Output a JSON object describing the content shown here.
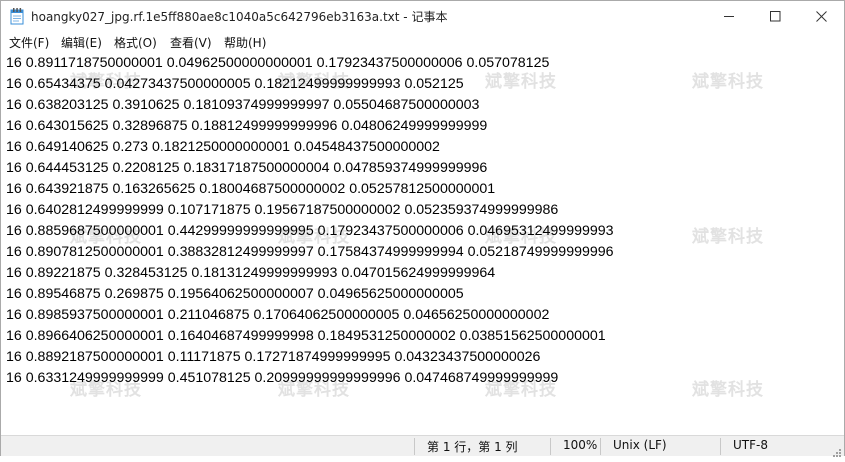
{
  "window": {
    "title": "hoangky027_jpg.rf.1e5ff880ae8c1040a5c642796eb3163a.txt - 记事本"
  },
  "menu": [
    {
      "label": "文件(F)"
    },
    {
      "label": "编辑(E)"
    },
    {
      "label": "格式(O)"
    },
    {
      "label": "查看(V)"
    },
    {
      "label": "帮助(H)"
    }
  ],
  "lines": [
    "16 0.8911718750000001 0.04962500000000001 0.17923437500000006 0.057078125",
    "16 0.65434375 0.04273437500000005 0.18212499999999993 0.052125",
    "16 0.638203125 0.3910625 0.18109374999999997 0.05504687500000003",
    "16 0.643015625 0.32896875 0.18812499999999996 0.04806249999999999",
    "16 0.649140625 0.273 0.1821250000000001 0.04548437500000002",
    "16 0.644453125 0.2208125 0.18317187500000004 0.047859374999999996",
    "16 0.643921875 0.163265625 0.18004687500000002 0.05257812500000001",
    "16 0.6402812499999999 0.107171875 0.19567187500000002 0.052359374999999986",
    "16 0.8859687500000001 0.44299999999999995 0.17923437500000006 0.04695312499999993",
    "16 0.8907812500000001 0.38832812499999997 0.17584374999999994 0.05218749999999996",
    "16 0.89221875 0.328453125 0.18131249999999993 0.047015624999999964",
    "16 0.89546875 0.269875 0.19564062500000007 0.04965625000000005",
    "16 0.8985937500000001 0.211046875 0.17064062500000005 0.04656250000000002",
    "16 0.8966406250000001 0.16404687499999998 0.1849531250000002 0.03851562500000001",
    "16 0.8892187500000001 0.11171875 0.17271874999999995 0.04323437500000026",
    "16 0.6331249999999999 0.451078125 0.20999999999999996 0.047468749999999999"
  ],
  "watermark": {
    "text": "斌擎科技"
  },
  "status": {
    "position": "第 1 行，第 1 列",
    "zoom": "100%",
    "line_ending": "Unix (LF)",
    "encoding": "UTF-8"
  },
  "colors": {
    "icon_blue": "#3a8fd8",
    "statusbar_bg": "#f0f0f0"
  },
  "icons": {
    "app": "notepad-icon",
    "minimize": "minimize-icon",
    "maximize": "maximize-icon",
    "close": "close-icon",
    "grip": "resize-grip-icon"
  }
}
